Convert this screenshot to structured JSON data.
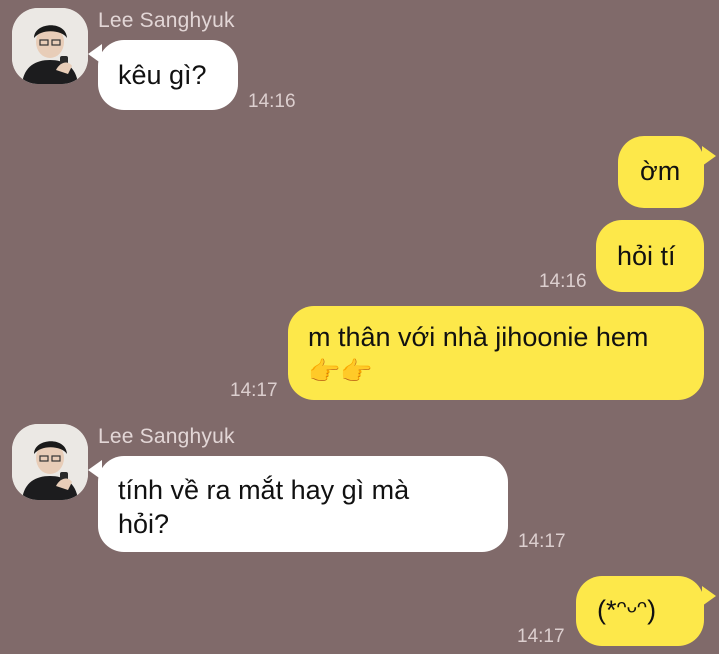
{
  "colors": {
    "background": "#806a6a",
    "incoming_bubble": "#ffffff",
    "outgoing_bubble": "#fde84a",
    "sender_text": "#e2d6d6",
    "time_text": "#dccfcf"
  },
  "contact": {
    "name": "Lee Sanghyuk"
  },
  "messages": [
    {
      "direction": "incoming",
      "text": "kêu gì?",
      "time": "14:16"
    },
    {
      "direction": "outgoing",
      "text": "ờm",
      "time": ""
    },
    {
      "direction": "outgoing",
      "text": "hỏi tí",
      "time": "14:16"
    },
    {
      "direction": "outgoing",
      "text": "m thân với nhà jihoonie hem",
      "emoji": "👉👉",
      "time": "14:17"
    },
    {
      "direction": "incoming",
      "text_line1": "tính về ra mắt hay gì mà",
      "text_line2": "hỏi?",
      "time": "14:17"
    },
    {
      "direction": "outgoing",
      "text": "(*ᵔᵕᵔ)",
      "time": "14:17"
    }
  ]
}
